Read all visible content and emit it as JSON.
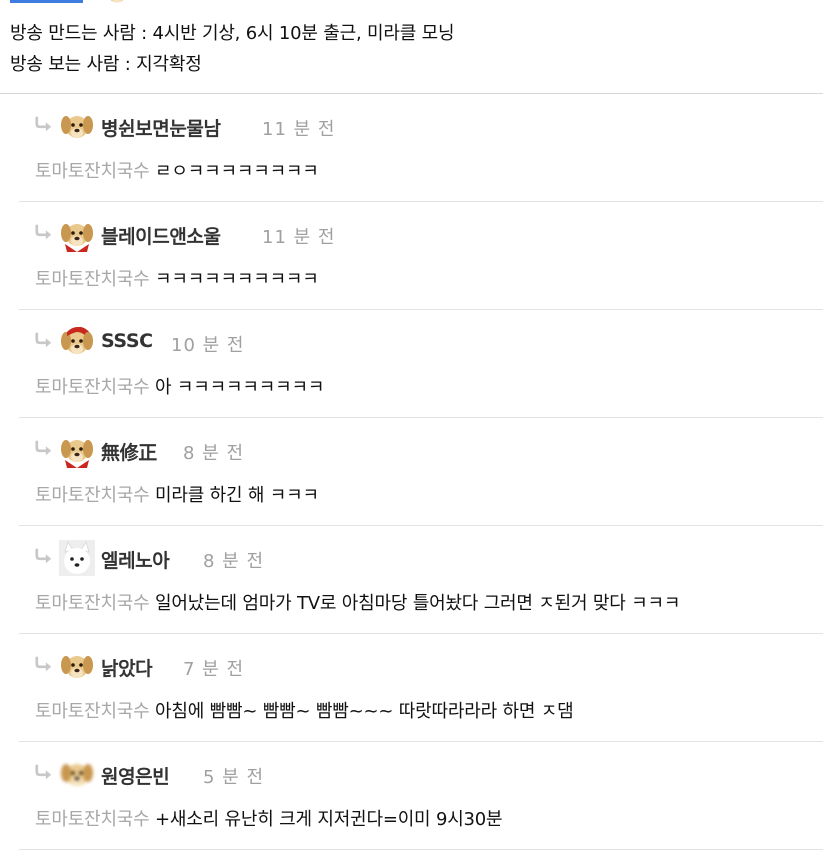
{
  "post": {
    "line1": "방송 만드는 사람 : 4시반 기상, 6시 10분 출근, 미라클 모닝",
    "line2": "방송 보는 사람 : 지각확정"
  },
  "replies": [
    {
      "nickname": "병쉰보면눈물남",
      "time": "11 분 전",
      "mention": "토마토잔치국수",
      "text": " ㄹㅇㅋㅋㅋㅋㅋㅋㅋㅋ",
      "avatar": "puppy-icon"
    },
    {
      "nickname": "블레이드앤소울",
      "time": "11 분 전",
      "mention": "토마토잔치국수",
      "text": " ㅋㅋㅋㅋㅋㅋㅋㅋㅋㅋ",
      "avatar": "puppy-red-cape-icon"
    },
    {
      "nickname": "SSSC",
      "time": "10 분 전",
      "mention": "토마토잔치국수",
      "text": " 아 ㅋㅋㅋㅋㅋㅋㅋㅋㅋ",
      "avatar": "puppy-red-hood-icon"
    },
    {
      "nickname": "無修正",
      "time": "8 분 전",
      "mention": "토마토잔치국수",
      "text": " 미라클 하긴 해 ㅋㅋㅋ",
      "avatar": "puppy-red-cape-icon"
    },
    {
      "nickname": "엘레노아",
      "time": "8 분 전",
      "mention": "토마토잔치국수",
      "text": " 일어났는데 엄마가 TV로 아침마당 틀어놨다 그러면 ㅈ된거 맞다 ㅋㅋㅋ",
      "avatar": "white-dog-icon"
    },
    {
      "nickname": "낡았다",
      "time": "7 분 전",
      "mention": "토마토잔치국수",
      "text": " 아침에 빰빰~ 빰빰~ 빰빰~~~ 따랏따라라라 하면 ㅈ댐",
      "avatar": "puppy-icon"
    },
    {
      "nickname": "원영은빈",
      "time": "5 분 전",
      "mention": "토마토잔치국수",
      "text": " +새소리 유난히 크게 지저귄다=이미 9시30분",
      "avatar": "blurred-puppy-icon"
    }
  ],
  "colors": {
    "accent": "#3d7de0",
    "mention": "#a7a7a7",
    "time": "#a0a0a0",
    "nickname": "#333333"
  }
}
